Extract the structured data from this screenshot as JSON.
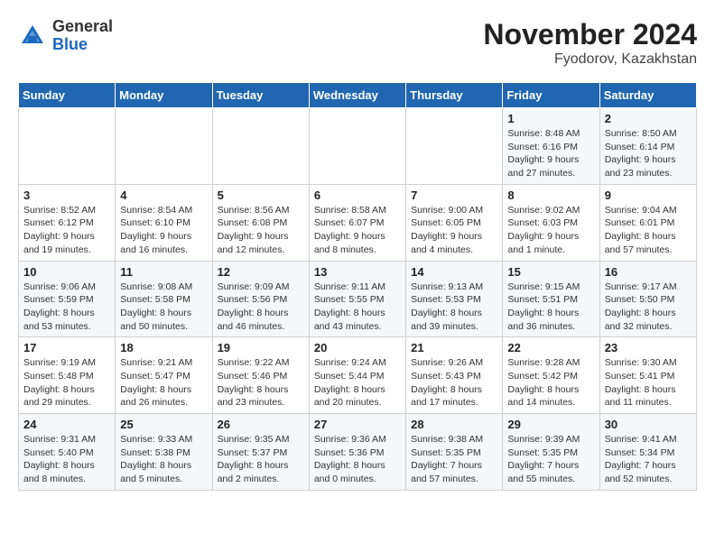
{
  "header": {
    "logo_general": "General",
    "logo_blue": "Blue",
    "month_title": "November 2024",
    "location": "Fyodorov, Kazakhstan"
  },
  "weekdays": [
    "Sunday",
    "Monday",
    "Tuesday",
    "Wednesday",
    "Thursday",
    "Friday",
    "Saturday"
  ],
  "weeks": [
    [
      {
        "day": "",
        "info": ""
      },
      {
        "day": "",
        "info": ""
      },
      {
        "day": "",
        "info": ""
      },
      {
        "day": "",
        "info": ""
      },
      {
        "day": "",
        "info": ""
      },
      {
        "day": "1",
        "info": "Sunrise: 8:48 AM\nSunset: 6:16 PM\nDaylight: 9 hours and 27 minutes."
      },
      {
        "day": "2",
        "info": "Sunrise: 8:50 AM\nSunset: 6:14 PM\nDaylight: 9 hours and 23 minutes."
      }
    ],
    [
      {
        "day": "3",
        "info": "Sunrise: 8:52 AM\nSunset: 6:12 PM\nDaylight: 9 hours and 19 minutes."
      },
      {
        "day": "4",
        "info": "Sunrise: 8:54 AM\nSunset: 6:10 PM\nDaylight: 9 hours and 16 minutes."
      },
      {
        "day": "5",
        "info": "Sunrise: 8:56 AM\nSunset: 6:08 PM\nDaylight: 9 hours and 12 minutes."
      },
      {
        "day": "6",
        "info": "Sunrise: 8:58 AM\nSunset: 6:07 PM\nDaylight: 9 hours and 8 minutes."
      },
      {
        "day": "7",
        "info": "Sunrise: 9:00 AM\nSunset: 6:05 PM\nDaylight: 9 hours and 4 minutes."
      },
      {
        "day": "8",
        "info": "Sunrise: 9:02 AM\nSunset: 6:03 PM\nDaylight: 9 hours and 1 minute."
      },
      {
        "day": "9",
        "info": "Sunrise: 9:04 AM\nSunset: 6:01 PM\nDaylight: 8 hours and 57 minutes."
      }
    ],
    [
      {
        "day": "10",
        "info": "Sunrise: 9:06 AM\nSunset: 5:59 PM\nDaylight: 8 hours and 53 minutes."
      },
      {
        "day": "11",
        "info": "Sunrise: 9:08 AM\nSunset: 5:58 PM\nDaylight: 8 hours and 50 minutes."
      },
      {
        "day": "12",
        "info": "Sunrise: 9:09 AM\nSunset: 5:56 PM\nDaylight: 8 hours and 46 minutes."
      },
      {
        "day": "13",
        "info": "Sunrise: 9:11 AM\nSunset: 5:55 PM\nDaylight: 8 hours and 43 minutes."
      },
      {
        "day": "14",
        "info": "Sunrise: 9:13 AM\nSunset: 5:53 PM\nDaylight: 8 hours and 39 minutes."
      },
      {
        "day": "15",
        "info": "Sunrise: 9:15 AM\nSunset: 5:51 PM\nDaylight: 8 hours and 36 minutes."
      },
      {
        "day": "16",
        "info": "Sunrise: 9:17 AM\nSunset: 5:50 PM\nDaylight: 8 hours and 32 minutes."
      }
    ],
    [
      {
        "day": "17",
        "info": "Sunrise: 9:19 AM\nSunset: 5:48 PM\nDaylight: 8 hours and 29 minutes."
      },
      {
        "day": "18",
        "info": "Sunrise: 9:21 AM\nSunset: 5:47 PM\nDaylight: 8 hours and 26 minutes."
      },
      {
        "day": "19",
        "info": "Sunrise: 9:22 AM\nSunset: 5:46 PM\nDaylight: 8 hours and 23 minutes."
      },
      {
        "day": "20",
        "info": "Sunrise: 9:24 AM\nSunset: 5:44 PM\nDaylight: 8 hours and 20 minutes."
      },
      {
        "day": "21",
        "info": "Sunrise: 9:26 AM\nSunset: 5:43 PM\nDaylight: 8 hours and 17 minutes."
      },
      {
        "day": "22",
        "info": "Sunrise: 9:28 AM\nSunset: 5:42 PM\nDaylight: 8 hours and 14 minutes."
      },
      {
        "day": "23",
        "info": "Sunrise: 9:30 AM\nSunset: 5:41 PM\nDaylight: 8 hours and 11 minutes."
      }
    ],
    [
      {
        "day": "24",
        "info": "Sunrise: 9:31 AM\nSunset: 5:40 PM\nDaylight: 8 hours and 8 minutes."
      },
      {
        "day": "25",
        "info": "Sunrise: 9:33 AM\nSunset: 5:38 PM\nDaylight: 8 hours and 5 minutes."
      },
      {
        "day": "26",
        "info": "Sunrise: 9:35 AM\nSunset: 5:37 PM\nDaylight: 8 hours and 2 minutes."
      },
      {
        "day": "27",
        "info": "Sunrise: 9:36 AM\nSunset: 5:36 PM\nDaylight: 8 hours and 0 minutes."
      },
      {
        "day": "28",
        "info": "Sunrise: 9:38 AM\nSunset: 5:35 PM\nDaylight: 7 hours and 57 minutes."
      },
      {
        "day": "29",
        "info": "Sunrise: 9:39 AM\nSunset: 5:35 PM\nDaylight: 7 hours and 55 minutes."
      },
      {
        "day": "30",
        "info": "Sunrise: 9:41 AM\nSunset: 5:34 PM\nDaylight: 7 hours and 52 minutes."
      }
    ]
  ]
}
